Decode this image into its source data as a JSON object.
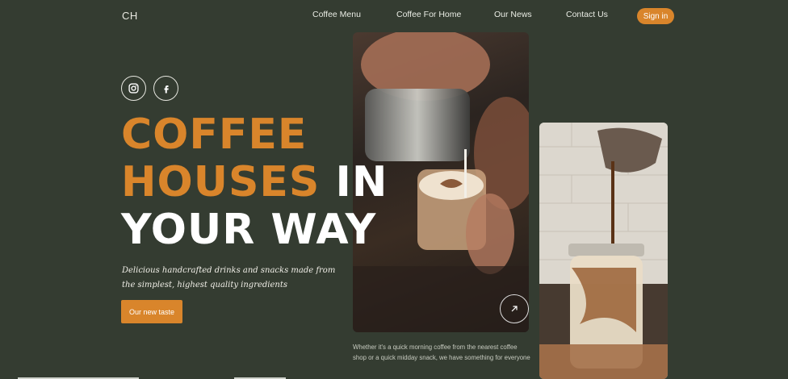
{
  "brand": {
    "logo": "CH"
  },
  "nav": {
    "items": [
      "Coffee Menu",
      "Coffee For Home",
      "Our News",
      "Contact Us"
    ],
    "signin": "Sign in"
  },
  "hero": {
    "title_line1": "COFFEE",
    "title_line2_orange": "HOUSES",
    "title_line2_white": "IN",
    "title_line3": "YOUR WAY",
    "tagline": "Delicious handcrafted drinks and snacks made from the simplest, highest quality ingredients",
    "cta": "Our new taste",
    "description": "Whether it's a quick morning coffee from the nearest coffee shop or a quick midday snack, we have something for everyone"
  },
  "icons": {
    "instagram": "instagram-icon",
    "facebook": "facebook-icon",
    "arrow": "arrow-up-right-icon"
  },
  "colors": {
    "background": "#343c31",
    "accent": "#d9852b",
    "text": "#ffffff"
  }
}
